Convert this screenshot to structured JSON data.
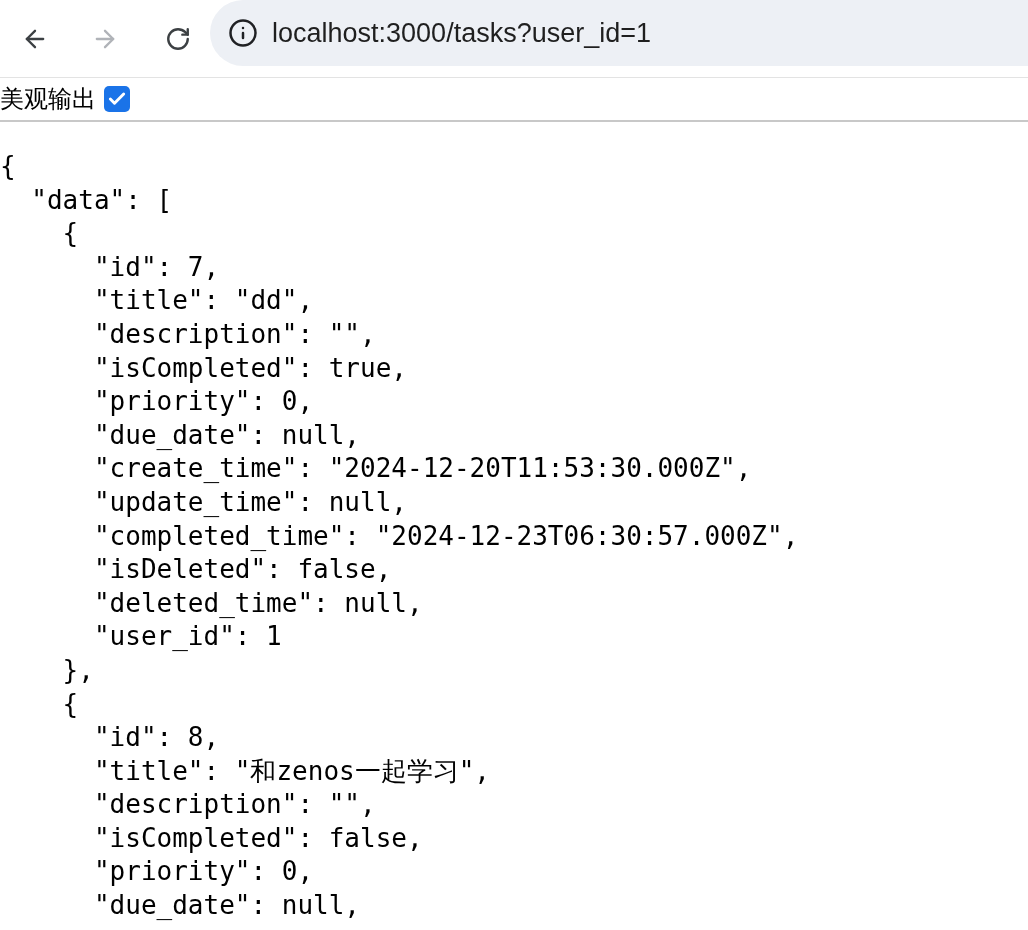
{
  "toolbar": {
    "back": {
      "disabled": false
    },
    "forward": {
      "disabled": true
    },
    "url": "localhost:3000/tasks?user_id=1"
  },
  "pretty_print": {
    "label": "美观输出",
    "checked": true
  },
  "json_lines": [
    "{",
    "  \"data\": [",
    "    {",
    "      \"id\": 7,",
    "      \"title\": \"dd\",",
    "      \"description\": \"\",",
    "      \"isCompleted\": true,",
    "      \"priority\": 0,",
    "      \"due_date\": null,",
    "      \"create_time\": \"2024-12-20T11:53:30.000Z\",",
    "      \"update_time\": null,",
    "      \"completed_time\": \"2024-12-23T06:30:57.000Z\",",
    "      \"isDeleted\": false,",
    "      \"deleted_time\": null,",
    "      \"user_id\": 1",
    "    },",
    "    {",
    "      \"id\": 8,",
    "      \"title\": \"和zenos一起学习\",",
    "      \"description\": \"\",",
    "      \"isCompleted\": false,",
    "      \"priority\": 0,",
    "      \"due_date\": null,"
  ]
}
